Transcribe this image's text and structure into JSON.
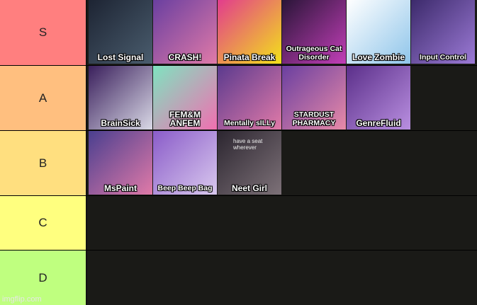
{
  "tiers": [
    {
      "label": "S",
      "color": "#ff7f7f",
      "items": [
        {
          "title": "Lost Signal",
          "bg": [
            "#1d2433",
            "#4a5d6e"
          ]
        },
        {
          "title": "CRASH!",
          "bg": [
            "#6a3fa0",
            "#e07aa8"
          ]
        },
        {
          "title": "Pinata Break",
          "bg": [
            "#e23c8d",
            "#f3e21a"
          ]
        },
        {
          "title": "Outrageous Cat Disorder",
          "bg": [
            "#2a1538",
            "#c23fb8"
          ]
        },
        {
          "title": "Love Zombie",
          "bg": [
            "#ffffff",
            "#8fc5ea"
          ]
        },
        {
          "title": "Input Control",
          "bg": [
            "#3c2a6b",
            "#9c7ad6"
          ]
        }
      ]
    },
    {
      "label": "A",
      "color": "#ffbf7f",
      "items": [
        {
          "title": "BrainSick",
          "bg": [
            "#3a1f5c",
            "#d9d9e6"
          ]
        },
        {
          "title": "FEM&M ANFEM",
          "bg": [
            "#7fe3c0",
            "#f06fb0"
          ]
        },
        {
          "title": "Mentally sILLy",
          "bg": [
            "#5b3a8e",
            "#e07aa8"
          ]
        },
        {
          "title": "STARDUST PHARMACY",
          "bg": [
            "#6a3fa0",
            "#e88aa8"
          ]
        },
        {
          "title": "GenreFluid",
          "bg": [
            "#5b2f8a",
            "#b98fe0"
          ]
        }
      ]
    },
    {
      "label": "B",
      "color": "#ffdf7f",
      "items": [
        {
          "title": "MsPaint",
          "bg": [
            "#4a3f8f",
            "#e07aa8"
          ]
        },
        {
          "title": "Beep Beep Bag",
          "bg": [
            "#8a5cc9",
            "#d9c8ee"
          ]
        },
        {
          "title": "Neet Girl",
          "bg": [
            "#2c2630",
            "#7d7178"
          ],
          "overlay": "have a seat wherever"
        }
      ]
    },
    {
      "label": "C",
      "color": "#ffff7f",
      "items": []
    },
    {
      "label": "D",
      "color": "#bfff7f",
      "items": []
    }
  ],
  "watermark": "imgflip.com"
}
